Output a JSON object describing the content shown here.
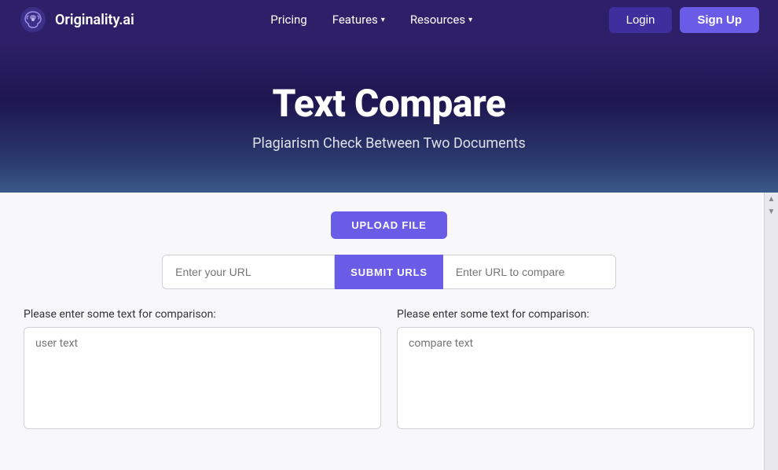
{
  "nav": {
    "logo_text": "Originality.ai",
    "pricing_label": "Pricing",
    "features_label": "Features",
    "resources_label": "Resources",
    "login_label": "Login",
    "signup_label": "Sign Up"
  },
  "hero": {
    "title": "Text Compare",
    "subtitle": "Plagiarism Check Between Two Documents"
  },
  "tool": {
    "upload_button": "UPLOAD FILE",
    "url_placeholder": "Enter your URL",
    "url_compare_placeholder": "Enter URL to compare",
    "submit_urls_button": "SUBMIT URLS",
    "left_label": "Please enter some text for comparison:",
    "right_label": "Please enter some text for comparison:",
    "left_textarea_placeholder": "user text",
    "right_textarea_placeholder": "compare text"
  },
  "colors": {
    "brand_purple": "#6b5ce7",
    "nav_bg": "#2d2068",
    "hero_gradient_start": "#2d2068"
  }
}
